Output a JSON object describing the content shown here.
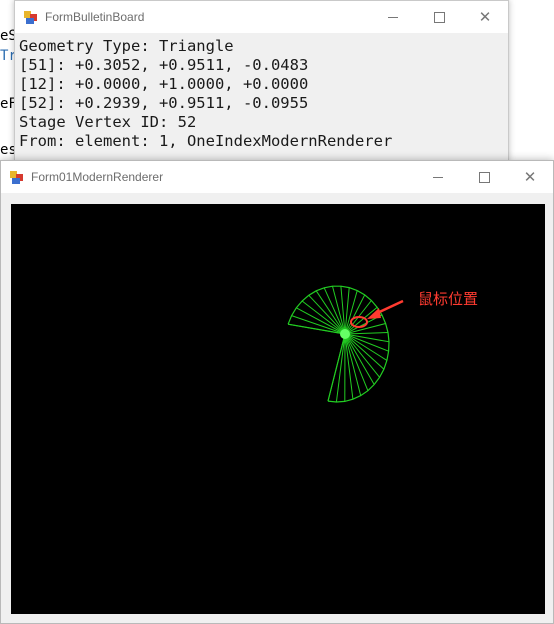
{
  "background": {
    "fragments": [
      "eS",
      "Tr",
      "eF",
      "es"
    ]
  },
  "bulletin_window": {
    "title": "FormBulletinBoard",
    "lines": [
      "Geometry Type: Triangle",
      "[51]: +0.3052, +0.9511, -0.0483",
      "[12]: +0.0000, +1.0000, +0.0000",
      "[52]: +0.2939, +0.9511, -0.0955",
      "Stage Vertex ID: 52",
      "From: element: 1, OneIndexModernRenderer"
    ],
    "close_glyph": "✕"
  },
  "renderer_window": {
    "title": "Form01ModernRenderer",
    "close_glyph": "✕",
    "annotation_label": "鼠标位置",
    "colors": {
      "background": "#000000",
      "wireframe": "#22cc22",
      "highlight": "#66ff66",
      "annotation": "#ff3b30"
    }
  }
}
